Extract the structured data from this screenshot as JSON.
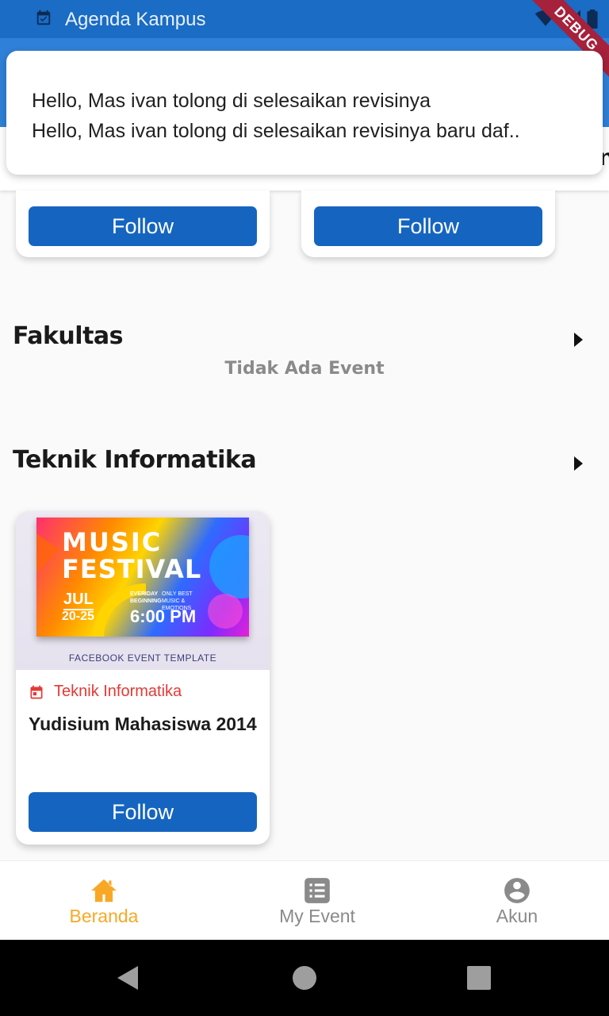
{
  "status_bar": {
    "app_name": "Agenda Kampus",
    "debug_label": "DEBUG"
  },
  "header_peek": {
    "char": "n"
  },
  "notification": {
    "line1": "Hello, Mas ivan tolong di selesaikan revisinya",
    "line2": "Hello, Mas ivan tolong di selesaikan revisinya baru daf.."
  },
  "top_cards": [
    {
      "follow_label": "Follow"
    },
    {
      "follow_label": "Follow"
    }
  ],
  "sections": {
    "fakultas": {
      "title": "Fakultas",
      "empty_text": "Tidak Ada Event"
    },
    "teknik": {
      "title": "Teknik Informatika"
    }
  },
  "event_card": {
    "poster": {
      "title1": "MUSIC",
      "title2": "FESTIVAL",
      "month": "JUL",
      "days": "20-25",
      "tagline_left": "EVERIDAY BEGINNING",
      "tagline_right": "ONLY BEST MUSIC & EMOTIONS",
      "time": "6:00 PM",
      "footer": "FACEBOOK EVENT TEMPLATE"
    },
    "category": "Teknik Informatika",
    "title": "Yudisium Mahasiswa 2014",
    "follow_label": "Follow"
  },
  "bottom_nav": [
    {
      "label": "Beranda",
      "icon": "home-icon",
      "active": true
    },
    {
      "label": "My Event",
      "icon": "list-icon",
      "active": false
    },
    {
      "label": "Akun",
      "icon": "account-circle-icon",
      "active": false
    }
  ],
  "colors": {
    "primary": "#1565c0",
    "status_bar": "#1a6cc4",
    "app_bar": "#2f80d8",
    "active_nav": "#f9a825",
    "inactive_nav": "#8a8a8a",
    "category": "#e53935"
  }
}
